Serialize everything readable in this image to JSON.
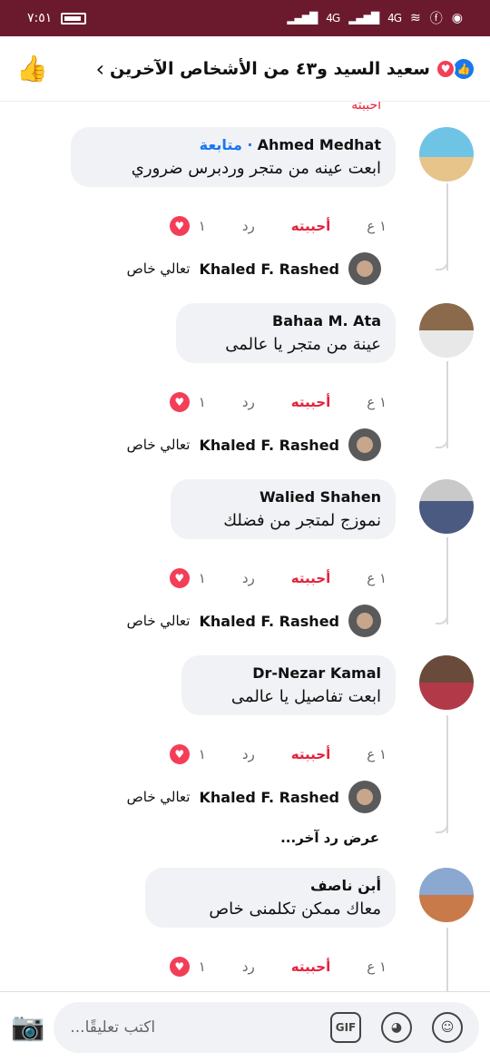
{
  "status": {
    "time": "٧:٥١",
    "net1": "4G",
    "net2": "4G"
  },
  "header": {
    "title": "سعيد السيد و٤٣ من الأشخاص الآخرين"
  },
  "stub_label": "أحببته",
  "comments": [
    {
      "name": "Ahmed Medhat",
      "follow": "· متابعة",
      "text": "ابعت عينه من متجر وردبرس ضروري",
      "time": "١ ع",
      "like": "أحببته",
      "reply": "رد",
      "count": "١",
      "reply_name": "Khaled F. Rashed",
      "reply_text": "تعالي خاص"
    },
    {
      "name": "Bahaa M. Ata",
      "text": "عينة من متجر يا عالمى",
      "time": "١ ع",
      "like": "أحببته",
      "reply": "رد",
      "count": "١",
      "reply_name": "Khaled F. Rashed",
      "reply_text": "تعالي خاص"
    },
    {
      "name": "Walied Shahen",
      "text": "نموزج لمتجر من فضلك",
      "time": "١ ع",
      "like": "أحببته",
      "reply": "رد",
      "count": "١",
      "reply_name": "Khaled F. Rashed",
      "reply_text": "تعالي خاص"
    },
    {
      "name": "Dr-Nezar Kamal",
      "text": "ابعت تفاصيل يا عالمى",
      "time": "١ ع",
      "like": "أحببته",
      "reply": "رد",
      "count": "١",
      "reply_name": "Khaled F. Rashed",
      "reply_text": "تعالي خاص",
      "more": "عرض رد آخر..."
    },
    {
      "name": "أبن ناصف",
      "text": "معاك ممكن تكلمنى خاص",
      "time": "١ ع",
      "like": "أحببته",
      "reply": "رد",
      "count": "١"
    }
  ],
  "composer": {
    "placeholder": "اكتب تعليقًا...",
    "gif": "GIF"
  }
}
